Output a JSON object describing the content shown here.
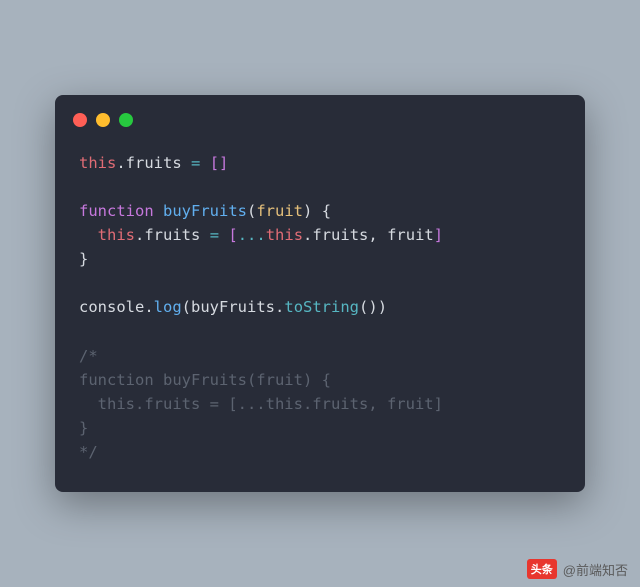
{
  "window": {
    "dots": [
      "close",
      "minimize",
      "maximize"
    ]
  },
  "code": {
    "l1": {
      "this": "this",
      "dot": ".",
      "prop": "fruits",
      "sp": " ",
      "eq": "=",
      "sp2": " ",
      "lb": "[",
      "rb": "]"
    },
    "l2": " ",
    "l3": {
      "kw": "function",
      "sp": " ",
      "fn": "buyFruits",
      "lp": "(",
      "param": "fruit",
      "rp": ")",
      "sp2": " ",
      "ob": "{"
    },
    "l4": {
      "indent": "  ",
      "this": "this",
      "dot": ".",
      "prop": "fruits",
      "sp": " ",
      "eq": "=",
      "sp2": " ",
      "lb": "[",
      "spread": "...",
      "this2": "this",
      "dot2": ".",
      "prop2": "fruits",
      "comma": ",",
      "sp3": " ",
      "arg": "fruit",
      "rb": "]"
    },
    "l5": {
      "cb": "}"
    },
    "l6": " ",
    "l7": {
      "console": "console",
      "dot": ".",
      "log": "log",
      "lp": "(",
      "fn": "buyFruits",
      "dot2": ".",
      "method": "toString",
      "lp2": "(",
      "rp2": ")",
      "rp": ")"
    },
    "l8": " ",
    "l9": "/*",
    "l10": "function buyFruits(fruit) {",
    "l11": "  this.fruits = [...this.fruits, fruit]",
    "l12": "}",
    "l13": "*/"
  },
  "watermark": {
    "badge": "头条",
    "handle": "@前端知否"
  }
}
